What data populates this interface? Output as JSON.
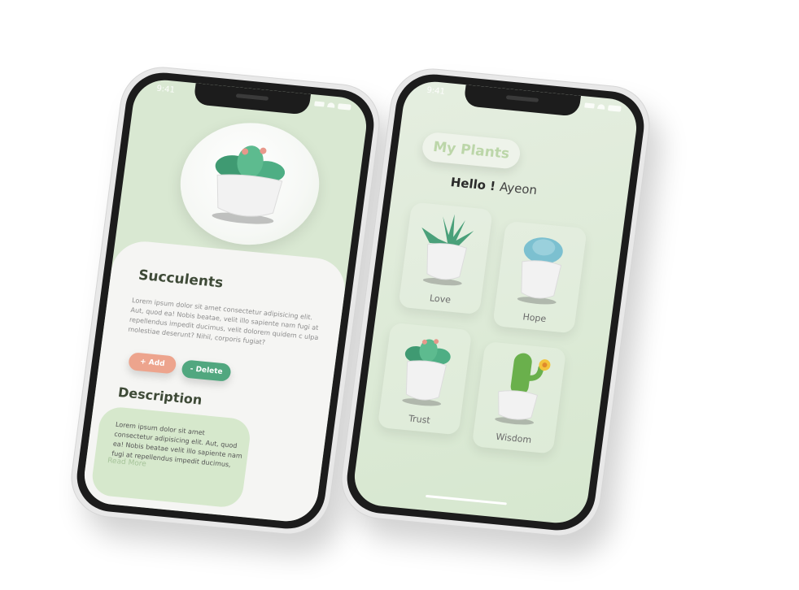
{
  "status_time": "9:41",
  "left": {
    "title": "Succulents",
    "lorem": "Lorem ipsum dolor sit amet consectetur adipisicing elit. Aut, quod ea! Nobis beatae, velit illo sapiente nam fugi at repellendus impedit ducimus, velit dolorem quidem c ulpa molestiae deserunt? Nihil, corporis fugiat?",
    "add_label": "+ Add",
    "delete_label": "- Delete",
    "description_title": "Description",
    "description_text": "Lorem ipsum dolor sit amet consectetur adipisicing elit. Aut, quod ea! Nobis beatae velit illo sapiente nam fugi at repellendus impedit ducimus,",
    "read_more": "Read More"
  },
  "right": {
    "header": "My Plants",
    "greeting": "Hello !",
    "user_name": "Ayeon",
    "plants": [
      {
        "name": "Love",
        "icon": "aloe-plant-icon"
      },
      {
        "name": "Hope",
        "icon": "blue-succulent-icon"
      },
      {
        "name": "Trust",
        "icon": "cactus-plant-icon"
      },
      {
        "name": "Wisdom",
        "icon": "flowering-cactus-icon"
      }
    ]
  },
  "colors": {
    "mint_bg": "#d9e8d2",
    "add_button": "#eda48d",
    "delete_button": "#51a77f",
    "heading": "#3e4a37"
  }
}
